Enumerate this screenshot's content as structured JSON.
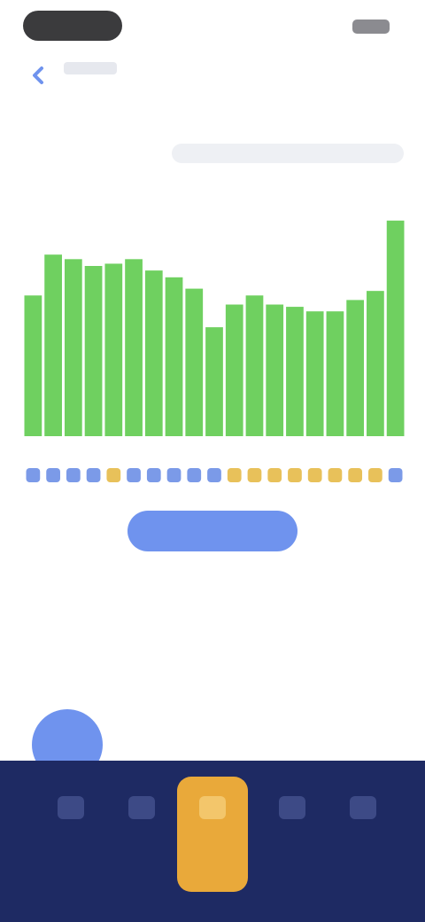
{
  "header": {
    "title": "",
    "subtitle": ""
  },
  "section": {
    "label": "",
    "filter_left": "",
    "filter_right": "",
    "caption": ""
  },
  "chart_data": {
    "type": "bar",
    "values": [
      62,
      80,
      78,
      75,
      76,
      78,
      73,
      70,
      65,
      48,
      58,
      62,
      58,
      57,
      55,
      55,
      60,
      64,
      95
    ],
    "ylim": [
      0,
      100
    ],
    "grid": false,
    "category_marker_colors": [
      "#7b9ae8",
      "#7b9ae8",
      "#7b9ae8",
      "#7b9ae8",
      "#e8c15a",
      "#7b9ae8",
      "#7b9ae8",
      "#7b9ae8",
      "#7b9ae8",
      "#7b9ae8",
      "#e8c15a",
      "#e8c15a",
      "#e8c15a",
      "#e8c15a",
      "#e8c15a",
      "#e8c15a",
      "#e8c15a",
      "#e8c15a",
      "#7b9ae8"
    ],
    "bar_color": "#6fd060"
  },
  "actions": {
    "primary_label": "",
    "helper_text": ""
  },
  "section2": {
    "title": "",
    "item": {
      "line1": "",
      "line2": ""
    }
  },
  "bottom_nav": {
    "items": [
      {
        "label": "",
        "active": false
      },
      {
        "label": "",
        "active": false
      },
      {
        "label": "",
        "active": true
      },
      {
        "label": "",
        "active": false
      },
      {
        "label": "",
        "active": false
      }
    ]
  },
  "colors": {
    "accent": "#6f93ee",
    "nav_background": "#1e2a63",
    "nav_active": "#e9a93a"
  }
}
